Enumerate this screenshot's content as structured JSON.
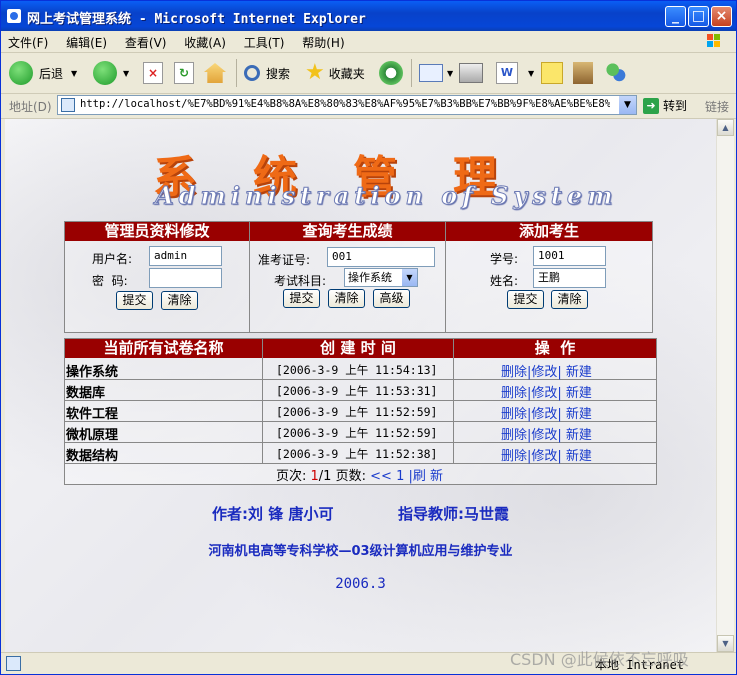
{
  "window": {
    "title": "网上考试管理系统 - Microsoft Internet Explorer",
    "buttons": {
      "minimize": "_",
      "maximize": "□",
      "close": "×"
    }
  },
  "menu": [
    "文件(F)",
    "编辑(E)",
    "查看(V)",
    "收藏(A)",
    "工具(T)",
    "帮助(H)"
  ],
  "toolbar": {
    "back": "后退",
    "search": "搜索",
    "favorites": "收藏夹"
  },
  "address": {
    "label": "地址(D)",
    "url": "http://localhost/%E7%BD%91%E4%B8%8A%E8%80%83%E8%AF%95%E7%B3%BB%E7%BB%9F%E8%AE%BE%E8%AE%A1%",
    "go": "转到",
    "links": "链接"
  },
  "logo": {
    "cn": "系统管理",
    "en": "Administration of System"
  },
  "admin_panel": {
    "title": "管理员资料修改",
    "username_label": "用户名:",
    "username_value": "admin",
    "password_label": "密  码:",
    "password_value": "",
    "submit": "提交",
    "clear": "清除"
  },
  "score_panel": {
    "title": "查询考生成绩",
    "ticket_label": "准考证号:",
    "ticket_value": "001",
    "subject_label": "考试科目:",
    "subject_value": "操作系统",
    "submit": "提交",
    "clear": "清除",
    "advanced": "高级"
  },
  "add_panel": {
    "title": "添加考生",
    "id_label": "学号:",
    "id_value": "1001",
    "name_label": "姓名:",
    "name_value": "王鹏",
    "submit": "提交",
    "clear": "清除"
  },
  "papers": {
    "headers": [
      "当前所有试卷名称",
      "创 建 时 间",
      "操  作"
    ],
    "rows": [
      {
        "name": "操作系统",
        "time": "[2006-3-9 上午 11:54:13]",
        "ops": "删除|修改| 新建"
      },
      {
        "name": "数据库",
        "time": "[2006-3-9 上午 11:53:31]",
        "ops": "删除|修改| 新建"
      },
      {
        "name": "软件工程",
        "time": "[2006-3-9 上午 11:52:59]",
        "ops": "删除|修改| 新建"
      },
      {
        "name": "微机原理",
        "time": "[2006-3-9 上午 11:52:59]",
        "ops": "删除|修改| 新建"
      },
      {
        "name": "数据结构",
        "time": "[2006-3-9 上午 11:52:38]",
        "ops": "删除|修改| 新建"
      }
    ],
    "pager": {
      "label_page": "页次:",
      "current": "1",
      "total": "/1",
      "label_pages": "页数:",
      "prev": "<<",
      "num": "1",
      "refresh": "|刷 新"
    }
  },
  "footer": {
    "author": "作者:刘 锋 唐小可",
    "teacher": "指导教师:马世霞",
    "school": "河南机电高等专科学校—03级计算机应用与维护专业",
    "date": "2006.3"
  },
  "status": {
    "zone": "本地 Intranet",
    "watermark": "CSDN @此候依不忘呼吸"
  },
  "colors": {
    "header_bg": "#990000",
    "logo_orange": "#ef6a16",
    "link_blue": "#1a3ccc"
  }
}
